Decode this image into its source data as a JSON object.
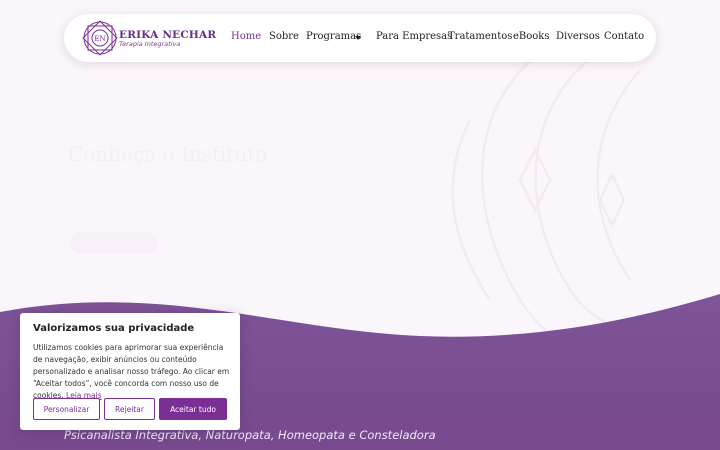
{
  "brand": {
    "name": "ERIKA NECHAR",
    "tagline": "Terapia Integrativa",
    "logo_initials": "EN"
  },
  "nav": {
    "home": "Home",
    "sobre": "Sobre",
    "programas": "Programas",
    "empresas": "Para Empresas",
    "tratamentos": "Tratamentos",
    "ebooks": "eBooks",
    "diversos": "Diversos",
    "contato": "Contato"
  },
  "hero": {
    "title": "Conheça o Instituto",
    "subtitle": "Psicanalista Integrativa, Naturopata, Homeopata e Consteladora"
  },
  "cookie": {
    "title": "Valorizamos sua privacidade",
    "text": "Utilizamos cookies para aprimorar sua experiência de navegação, exibir anúncios ou conteúdo personalizado e analisar nosso tráfego. Ao clicar em “Aceitar todos”, você concorda com nosso uso de cookies.",
    "link": "Leia mais",
    "customize": "Personalizar",
    "reject": "Rejeitar",
    "accept": "Aceitar tudo"
  },
  "colors": {
    "brand": "#7b2f95",
    "hero_background": "#fbf6fb",
    "wave_purple": "#7a4e96"
  }
}
